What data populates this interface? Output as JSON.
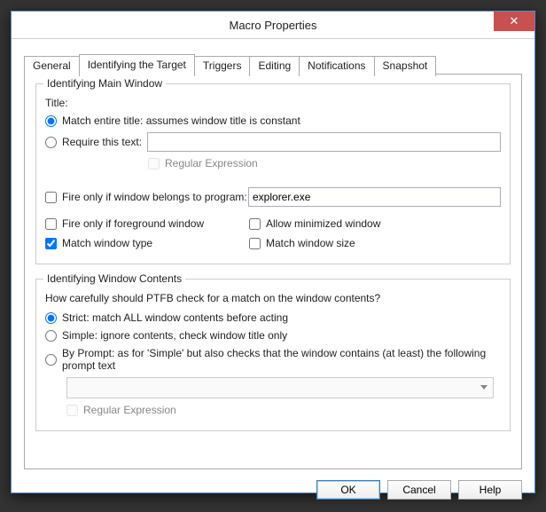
{
  "window": {
    "title": "Macro Properties",
    "close": "✕"
  },
  "tabs": {
    "general": "General",
    "identifying": "Identifying the Target",
    "triggers": "Triggers",
    "editing": "Editing",
    "notifications": "Notifications",
    "snapshot": "Snapshot"
  },
  "mainWindow": {
    "legend": "Identifying Main Window",
    "titleLabel": "Title:",
    "matchEntire": "Match entire title: assumes window title is constant",
    "requireText": "Require this text:",
    "requireTextValue": "",
    "regex": "Regular Expression",
    "fireProgram": "Fire only if window belongs to program:",
    "programValue": "explorer.exe",
    "fireForeground": "Fire only if foreground window",
    "allowMinimized": "Allow minimized window",
    "matchType": "Match window type",
    "matchSize": "Match window size"
  },
  "contents": {
    "legend": "Identifying Window Contents",
    "question": "How carefully should PTFB check for a match on the window contents?",
    "strict": "Strict: match ALL window contents before acting",
    "simple": "Simple: ignore contents, check window title only",
    "byPrompt": "By Prompt: as for 'Simple' but also checks that the window contains (at least) the following prompt text",
    "promptValue": "",
    "regex": "Regular Expression"
  },
  "buttons": {
    "ok": "OK",
    "cancel": "Cancel",
    "help": "Help"
  }
}
